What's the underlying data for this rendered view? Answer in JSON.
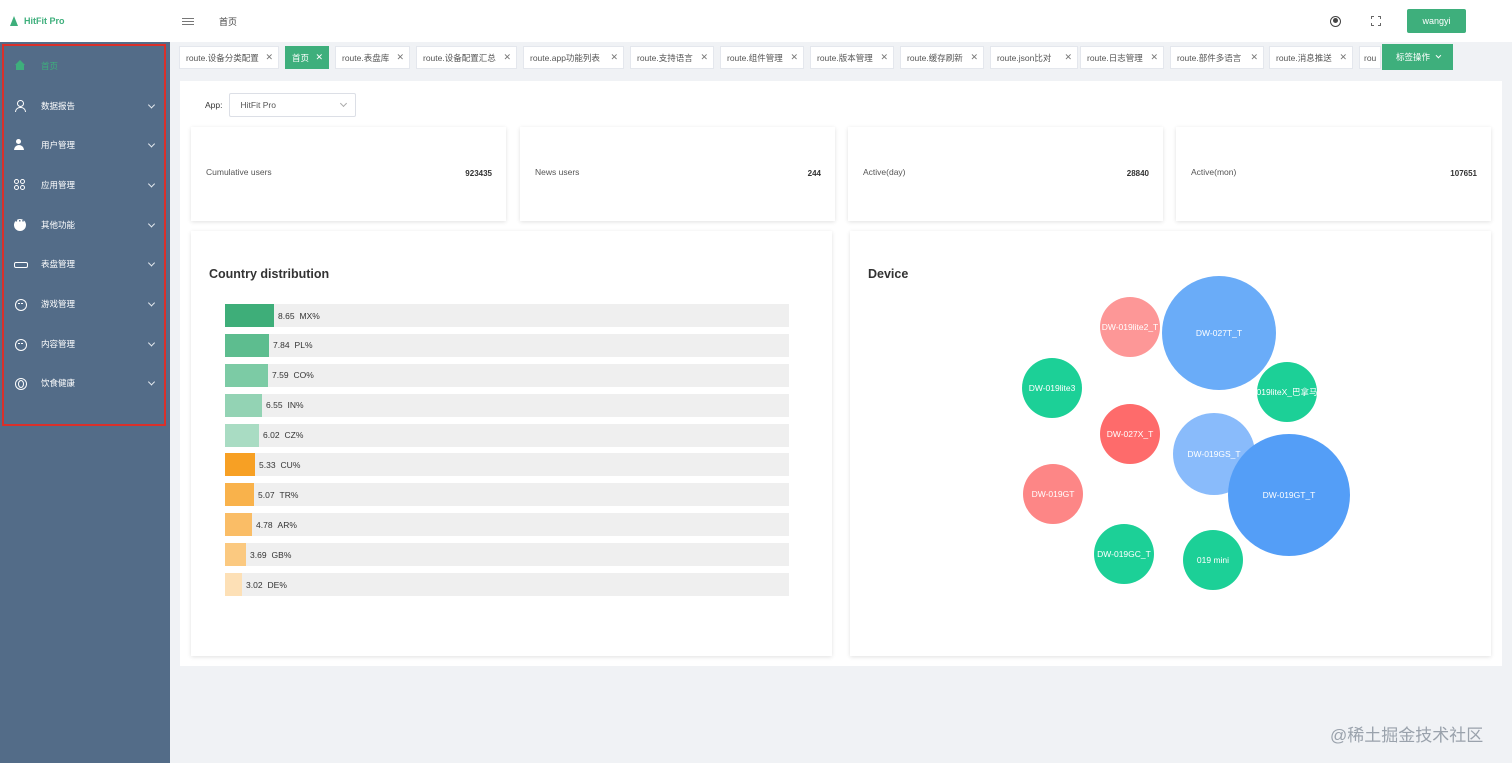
{
  "app": {
    "logo_text": "HitFit Pro"
  },
  "header": {
    "breadcrumb": "首页",
    "user": "wangyi"
  },
  "sidebar": {
    "items": [
      {
        "label": "首页",
        "icon": "home-icon"
      },
      {
        "label": "数据报告",
        "icon": "user-icon"
      },
      {
        "label": "用户管理",
        "icon": "user-gear-icon"
      },
      {
        "label": "应用管理",
        "icon": "apps-icon"
      },
      {
        "label": "其他功能",
        "icon": "more-icon"
      },
      {
        "label": "表盘管理",
        "icon": "dial-icon"
      },
      {
        "label": "游戏管理",
        "icon": "game-icon"
      },
      {
        "label": "内容管理",
        "icon": "content-icon"
      },
      {
        "label": "饮食健康",
        "icon": "food-icon"
      }
    ]
  },
  "tags": {
    "items": [
      {
        "label": "route.设备分类配置"
      },
      {
        "label": "首页"
      },
      {
        "label": "route.表盘库"
      },
      {
        "label": "route.设备配置汇总"
      },
      {
        "label": "route.app功能列表"
      },
      {
        "label": "route.支持语言"
      },
      {
        "label": "route.组件管理"
      },
      {
        "label": "route.版本管理"
      },
      {
        "label": "route.缓存刷新"
      },
      {
        "label": "route.json比对"
      },
      {
        "label": "route.日志管理"
      },
      {
        "label": "route.部件多语言"
      },
      {
        "label": "route.消息推送"
      },
      {
        "label": "rou"
      }
    ],
    "ops_label": "标签操作"
  },
  "filter": {
    "label": "App:",
    "value": "HitFit Pro"
  },
  "stats": [
    {
      "label": "Cumulative users",
      "value": "923435"
    },
    {
      "label": "News users",
      "value": "244"
    },
    {
      "label": "Active(day)",
      "value": "28840"
    },
    {
      "label": "Active(mon)",
      "value": "107651"
    }
  ],
  "country_panel": {
    "title": "Country distribution"
  },
  "device_panel": {
    "title": "Device"
  },
  "chart_data": [
    {
      "type": "bar",
      "title": "Country distribution",
      "orientation": "horizontal",
      "categories": [
        "MX%",
        "PL%",
        "CO%",
        "IN%",
        "CZ%",
        "CU%",
        "TR%",
        "AR%",
        "GB%",
        "DE%"
      ],
      "values": [
        8.65,
        7.84,
        7.59,
        6.55,
        6.02,
        5.33,
        5.07,
        4.78,
        3.69,
        3.02
      ],
      "labels": [
        "8.65",
        "7.84",
        "7.59",
        "6.55",
        "6.02",
        "5.33",
        "5.07",
        "4.78",
        "3.69",
        "3.02"
      ],
      "colors": [
        "#3eae79",
        "#5dbd8f",
        "#7ccba5",
        "#93d3b4",
        "#a9dcc3",
        "#f7a024",
        "#f9b24b",
        "#fabd66",
        "#fbc980",
        "#fde0b6"
      ],
      "xlim": [
        0,
        100
      ]
    },
    {
      "type": "bubble",
      "title": "Device",
      "points": [
        {
          "label": "DW-019lite2_T",
          "size": 30,
          "color": "#fd9797"
        },
        {
          "label": "DW-027T_T",
          "size": 57,
          "color": "#6aacf8"
        },
        {
          "label": "DW-019lite3",
          "size": 30,
          "color": "#1cd097"
        },
        {
          "label": "019liteX_巴拿马",
          "size": 30,
          "color": "#1cd097"
        },
        {
          "label": "DW-027X_T",
          "size": 30,
          "color": "#fe6b6b"
        },
        {
          "label": "DW-019GS_T",
          "size": 41,
          "color": "#89bbfb"
        },
        {
          "label": "DW-019GT",
          "size": 30,
          "color": "#fd8686"
        },
        {
          "label": "DW-019GT_T",
          "size": 61,
          "color": "#549ef7"
        },
        {
          "label": "DW-019GC_T",
          "size": 30,
          "color": "#1cd097"
        },
        {
          "label": "019 mini",
          "size": 30,
          "color": "#1cd097"
        }
      ]
    }
  ],
  "watermark": "@稀土掘金技术社区"
}
